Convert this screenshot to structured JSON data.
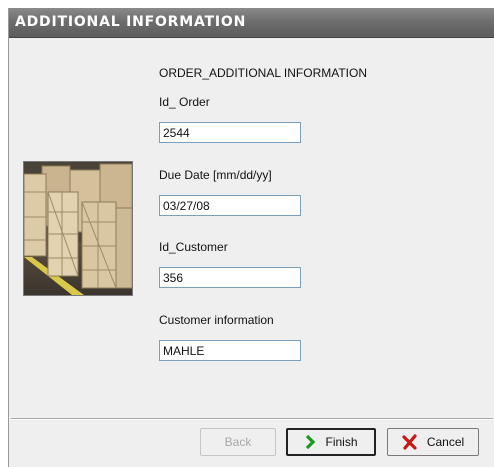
{
  "window": {
    "title": "ADDITIONAL INFORMATION"
  },
  "form": {
    "heading": "ORDER_ADDITIONAL INFORMATION",
    "id_order": {
      "label": "Id_ Order",
      "value": "2544"
    },
    "due_date": {
      "label": "Due Date [mm/dd/yy]",
      "value": "03/27/08"
    },
    "id_customer": {
      "label": "Id_Customer",
      "value": "356"
    },
    "customer_info": {
      "label": "Customer information",
      "value": "MAHLE"
    }
  },
  "buttons": {
    "back": "Back",
    "finish": "Finish",
    "cancel": "Cancel"
  },
  "icons": {
    "finish": "green-arrow-right-icon",
    "cancel": "red-x-icon"
  },
  "colors": {
    "titlebar": "#6e6e6e",
    "window_bg": "#efefef",
    "finish_icon": "#1a9b1a",
    "cancel_icon": "#c81818"
  }
}
